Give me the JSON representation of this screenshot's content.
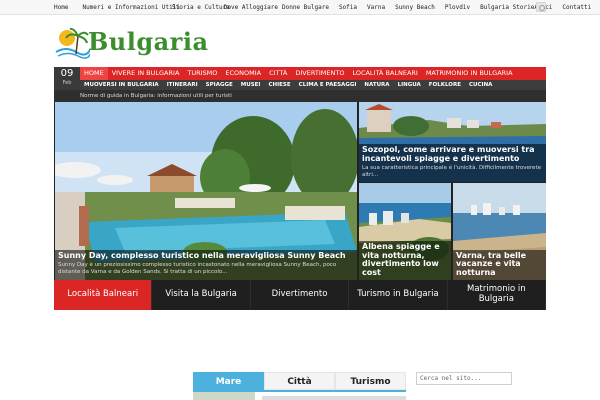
{
  "topnav": {
    "items": [
      "Home",
      "Numeri e Informazioni Utili",
      "Storia e Cultura",
      "Dove Alloggiare",
      "Donne Bulgare",
      "Sofia",
      "Varna",
      "Sunny Beach",
      "Plovdiv",
      "Bulgaria Storie",
      "Amici",
      "Contatti"
    ]
  },
  "logo": {
    "text": "Bulgaria",
    "colors": {
      "green": "#3a8e2b",
      "sun": "#f6b61d"
    }
  },
  "date": {
    "day": "09",
    "month": "Feb"
  },
  "mainnav": {
    "items": [
      "HOME",
      "VIVERE IN BULGARIA",
      "TURISMO",
      "ECONOMIA",
      "CITTÀ",
      "DIVERTIMENTO",
      "LOCALITÀ BALNEARI",
      "MATRIMONIO IN BULGARIA"
    ],
    "accent": "#dc2626"
  },
  "subnav": {
    "items": [
      "MUOVERSI IN BULGARIA",
      "ITINERARI",
      "SPIAGGE",
      "MUSEI",
      "CHIESE",
      "CLIMA E PAESAGGI",
      "NATURA",
      "LINGUA",
      "FOLKLORE",
      "CUCINA"
    ]
  },
  "ticker": {
    "text": "Norme di guida in Bulgaria: informazioni utili per turisti"
  },
  "slides": {
    "main": {
      "title": "Sunny Day, complesso turistico nella meravigliosa Sunny Beach",
      "excerpt": "Sunny Day è un preziosissimo complesso turistico incastonato nella meravigliosa Sunny Beach, poco distante da Varna e da Golden Sands. Si tratta di un piccolo..."
    },
    "top_right": {
      "title": "Sozopol, come arrivare e muoversi tra incantevoli spiagge e divertimento",
      "excerpt": "La sua caratteristica principale è l'unicità. Difficilmente troverete altri..."
    },
    "bottom_left": {
      "title": "Albena spiagge e vita notturna, divertimento low cost"
    },
    "bottom_right": {
      "title": "Varna, tra belle vacanze e vita notturna"
    }
  },
  "categories": {
    "items": [
      "Località Balneari",
      "Visita la Bulgaria",
      "Divertimento",
      "Turismo in Bulgaria",
      "Matrimonio in Bulgaria"
    ],
    "active_index": 0
  },
  "bottom_tabs": {
    "items": [
      "Mare",
      "Città",
      "Turismo"
    ],
    "active_index": 0,
    "accent": "#4db1dd"
  },
  "search": {
    "placeholder": "Cerca nel sito..."
  }
}
